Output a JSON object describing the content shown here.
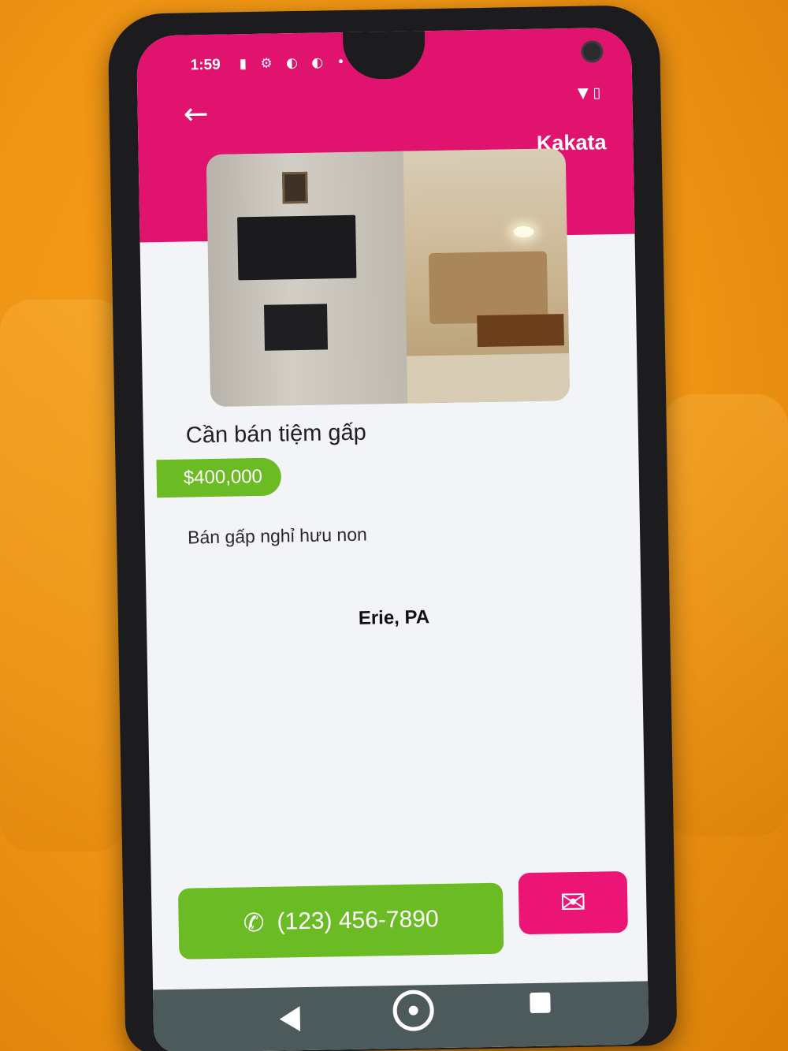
{
  "status_bar": {
    "time": "1:59",
    "left_icons": "▮ ⚙ ◐ ◐ •",
    "right_icons": "▼ ▯"
  },
  "app_bar": {
    "back_icon": "arrow-left-icon",
    "title": "Kakata"
  },
  "listing": {
    "photo": "living-room-photo",
    "title": "Cần bán tiệm gấp",
    "price": "$400,000",
    "description": "Bán gấp nghỉ hưu non",
    "location": "Erie, PA"
  },
  "actions": {
    "phone_icon": "phone-icon",
    "phone_number": "(123) 456-7890",
    "email_icon": "envelope-icon"
  },
  "colors": {
    "primary": "#e0136f",
    "accent_green": "#6bbb24",
    "email_pink": "#ec1474",
    "nav_bar": "#4d5a5c"
  }
}
